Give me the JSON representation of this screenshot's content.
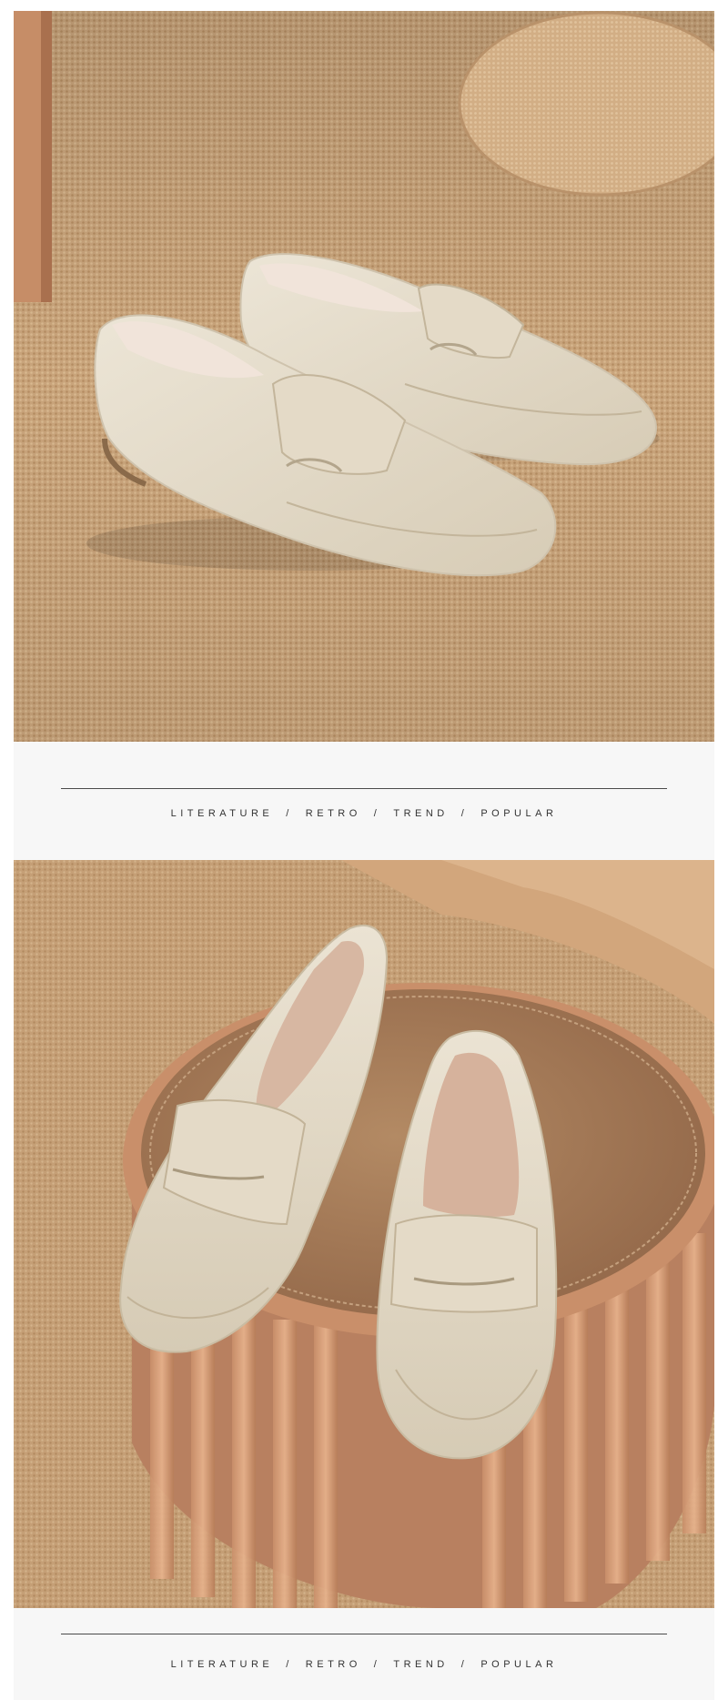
{
  "colors": {
    "background": "#ffffff",
    "divider_band": "#f7f7f7",
    "rule": "#4a4a4a",
    "text": "#333333",
    "suede": "#e2d9c8",
    "carpet": "#c7a37a",
    "stool_top": "#a97f5a"
  },
  "images": [
    {
      "subject": "pair of beige suede penny loafers on woven carpet"
    },
    {
      "subject": "pair of beige suede penny loafers on a round pleated stool"
    }
  ],
  "tagline": {
    "words": [
      "LITERATURE",
      "RETRO",
      "TREND",
      "POPULAR"
    ],
    "separator": "/"
  }
}
